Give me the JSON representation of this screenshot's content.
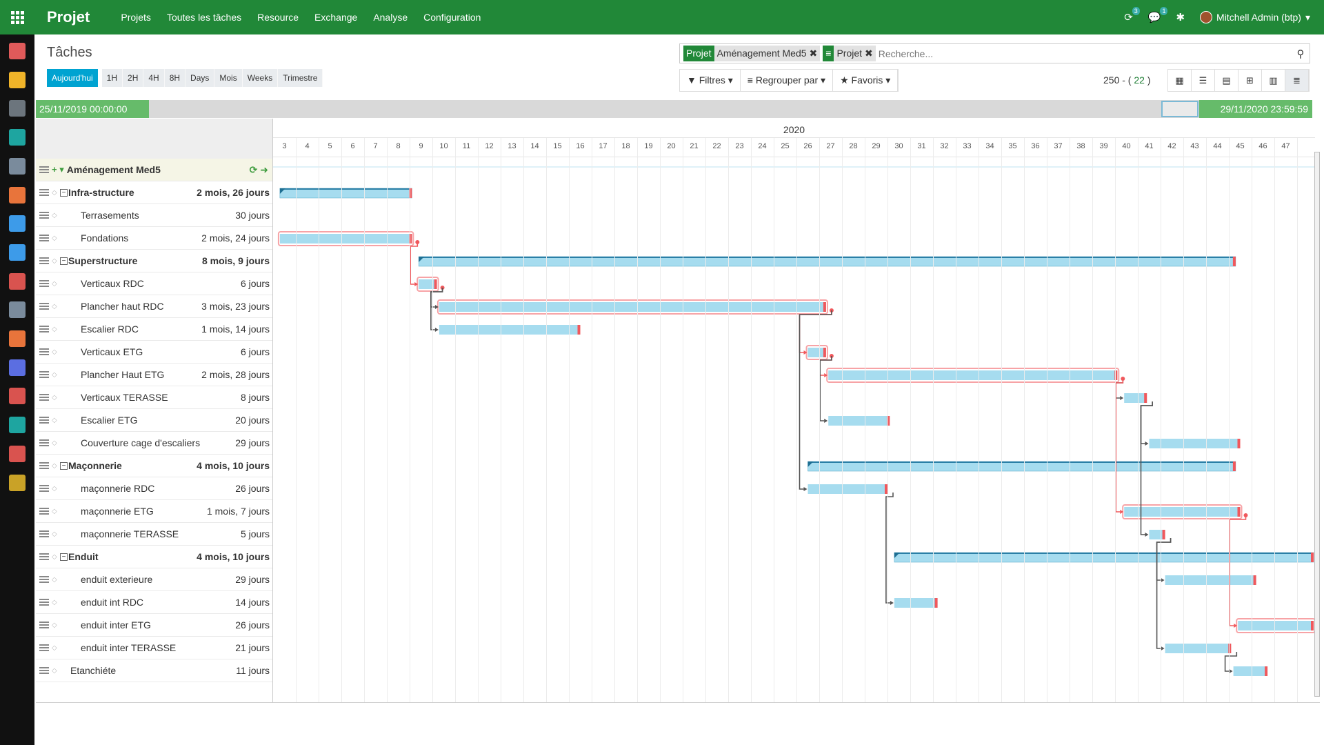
{
  "app": {
    "name": "Projet"
  },
  "menu": [
    "Projets",
    "Toutes les tâches",
    "Resource",
    "Exchange",
    "Analyse",
    "Configuration"
  ],
  "topbar": {
    "activity_count": "3",
    "message_count": "1",
    "user": "Mitchell Admin (btp)"
  },
  "sidebar_icons": [
    {
      "name": "discuss-icon",
      "color": "#e05a5a"
    },
    {
      "name": "calendar-icon",
      "color": "#f0b429"
    },
    {
      "name": "notes-icon",
      "color": "#6c757d"
    },
    {
      "name": "contacts-icon",
      "color": "#1ea5a0"
    },
    {
      "name": "crm-icon",
      "color": "#7a8b9c"
    },
    {
      "name": "sales-icon",
      "color": "#e8743b"
    },
    {
      "name": "dashboard-icon",
      "color": "#3d9be9"
    },
    {
      "name": "invoicing-icon",
      "color": "#3d9be9"
    },
    {
      "name": "inventory-icon",
      "color": "#d9534f"
    },
    {
      "name": "link-icon",
      "color": "#7a8b9c"
    },
    {
      "name": "documents-icon",
      "color": "#e8743b"
    },
    {
      "name": "apps-puzzle-icon",
      "color": "#5b6ee1"
    },
    {
      "name": "timesheet-icon",
      "color": "#d9534f"
    },
    {
      "name": "employees-icon",
      "color": "#1ea5a0"
    },
    {
      "name": "users-icon",
      "color": "#d9534f"
    },
    {
      "name": "settings-icon",
      "color": "#c9a227"
    }
  ],
  "page_title": "Tâches",
  "scales": {
    "today": "Aujourd'hui",
    "items": [
      "1H",
      "2H",
      "4H",
      "8H",
      "Days",
      "Mois",
      "Weeks",
      "Trimestre"
    ]
  },
  "search": {
    "facets": [
      {
        "category": "Projet",
        "value": "Aménagement Med5"
      },
      {
        "category": "≡",
        "value": "Projet"
      }
    ],
    "placeholder": "Recherche..."
  },
  "filters": {
    "filters_label": "Filtres",
    "group_label": "Regrouper par",
    "favorites_label": "Favoris"
  },
  "pager": {
    "total": "250 - (",
    "count": "22",
    "close": ")"
  },
  "dates": {
    "start": "25/11/2019 00:00:00",
    "end": "29/11/2020 23:59:59"
  },
  "gantt": {
    "year": "2020",
    "weeks": [
      "3",
      "4",
      "5",
      "6",
      "7",
      "8",
      "9",
      "10",
      "11",
      "12",
      "13",
      "14",
      "15",
      "16",
      "17",
      "18",
      "19",
      "20",
      "21",
      "22",
      "23",
      "24",
      "25",
      "26",
      "27",
      "28",
      "29",
      "30",
      "31",
      "32",
      "33",
      "34",
      "35",
      "36",
      "37",
      "38",
      "39",
      "40",
      "41",
      "42",
      "43",
      "44",
      "45",
      "46",
      "47"
    ],
    "tasks": [
      {
        "name": "Aménagement Med5",
        "duration": "",
        "type": "project"
      },
      {
        "name": "Infra-structure",
        "duration": "2 mois, 26 jours",
        "type": "group"
      },
      {
        "name": "Terrasements",
        "duration": "30 jours",
        "type": "task"
      },
      {
        "name": "Fondations",
        "duration": "2 mois, 24 jours",
        "type": "task"
      },
      {
        "name": "Superstructure",
        "duration": "8 mois, 9 jours",
        "type": "group"
      },
      {
        "name": "Verticaux RDC",
        "duration": "6 jours",
        "type": "task"
      },
      {
        "name": "Plancher haut RDC",
        "duration": "3 mois, 23 jours",
        "type": "task"
      },
      {
        "name": "Escalier RDC",
        "duration": "1 mois, 14 jours",
        "type": "task"
      },
      {
        "name": "Verticaux ETG",
        "duration": "6 jours",
        "type": "task"
      },
      {
        "name": "Plancher Haut ETG",
        "duration": "2 mois, 28 jours",
        "type": "task"
      },
      {
        "name": "Verticaux TERASSE",
        "duration": "8 jours",
        "type": "task"
      },
      {
        "name": "Escalier ETG",
        "duration": "20 jours",
        "type": "task"
      },
      {
        "name": "Couverture cage d'escaliers",
        "duration": "29 jours",
        "type": "task"
      },
      {
        "name": "Maçonnerie",
        "duration": "4 mois, 10 jours",
        "type": "group"
      },
      {
        "name": "maçonnerie RDC",
        "duration": "26 jours",
        "type": "task"
      },
      {
        "name": "maçonnerie ETG",
        "duration": "1 mois, 7 jours",
        "type": "task"
      },
      {
        "name": "maçonnerie TERASSE",
        "duration": "5 jours",
        "type": "task"
      },
      {
        "name": "Enduit",
        "duration": "4 mois, 10 jours",
        "type": "group"
      },
      {
        "name": "enduit exterieure",
        "duration": "29 jours",
        "type": "task"
      },
      {
        "name": "enduit int RDC",
        "duration": "14 jours",
        "type": "task"
      },
      {
        "name": "enduit inter ETG",
        "duration": "26 jours",
        "type": "task"
      },
      {
        "name": "enduit inter TERASSE",
        "duration": "21 jours",
        "type": "task"
      },
      {
        "name": "Etanchiéte",
        "duration": "11 jours",
        "type": "task"
      }
    ],
    "bars": [
      {
        "row": 1,
        "start_week": 2.8,
        "end_week": 8.6,
        "kind": "group",
        "critical": false
      },
      {
        "row": 3,
        "start_week": 2.8,
        "end_week": 8.6,
        "kind": "task",
        "critical": true
      },
      {
        "row": 4,
        "start_week": 8.9,
        "end_week": 44.8,
        "kind": "group",
        "critical": false
      },
      {
        "row": 5,
        "start_week": 8.9,
        "end_week": 9.7,
        "kind": "task",
        "critical": true
      },
      {
        "row": 6,
        "start_week": 9.8,
        "end_week": 26.8,
        "kind": "task",
        "critical": true
      },
      {
        "row": 7,
        "start_week": 9.8,
        "end_week": 16.0,
        "kind": "task",
        "critical": false
      },
      {
        "row": 8,
        "start_week": 26.0,
        "end_week": 26.8,
        "kind": "task",
        "critical": true
      },
      {
        "row": 9,
        "start_week": 26.9,
        "end_week": 39.6,
        "kind": "task",
        "critical": true
      },
      {
        "row": 10,
        "start_week": 39.9,
        "end_week": 40.9,
        "kind": "task",
        "critical": false
      },
      {
        "row": 11,
        "start_week": 26.9,
        "end_week": 29.6,
        "kind": "task",
        "critical": false
      },
      {
        "row": 12,
        "start_week": 41.0,
        "end_week": 45.0,
        "kind": "task",
        "critical": false
      },
      {
        "row": 13,
        "start_week": 26.0,
        "end_week": 44.8,
        "kind": "group",
        "critical": false
      },
      {
        "row": 14,
        "start_week": 26.0,
        "end_week": 29.5,
        "kind": "task",
        "critical": false
      },
      {
        "row": 15,
        "start_week": 39.9,
        "end_week": 45.0,
        "kind": "task",
        "critical": true
      },
      {
        "row": 16,
        "start_week": 41.0,
        "end_week": 41.7,
        "kind": "task",
        "critical": false
      },
      {
        "row": 17,
        "start_week": 29.8,
        "end_week": 48.7,
        "kind": "group",
        "critical": false
      },
      {
        "row": 18,
        "start_week": 41.7,
        "end_week": 45.7,
        "kind": "task",
        "critical": false
      },
      {
        "row": 19,
        "start_week": 29.8,
        "end_week": 31.7,
        "kind": "task",
        "critical": false
      },
      {
        "row": 20,
        "start_week": 44.9,
        "end_week": 48.7,
        "kind": "task",
        "critical": true
      },
      {
        "row": 21,
        "start_week": 41.7,
        "end_week": 44.6,
        "kind": "task",
        "critical": false
      },
      {
        "row": 22,
        "start_week": 44.7,
        "end_week": 46.2,
        "kind": "task",
        "critical": false
      }
    ]
  },
  "colors": {
    "brand": "#218838",
    "bar": "#a6dcef",
    "bar_border": "#7ec7e4",
    "critical": "#f0585c",
    "today": "#00a3d1"
  }
}
